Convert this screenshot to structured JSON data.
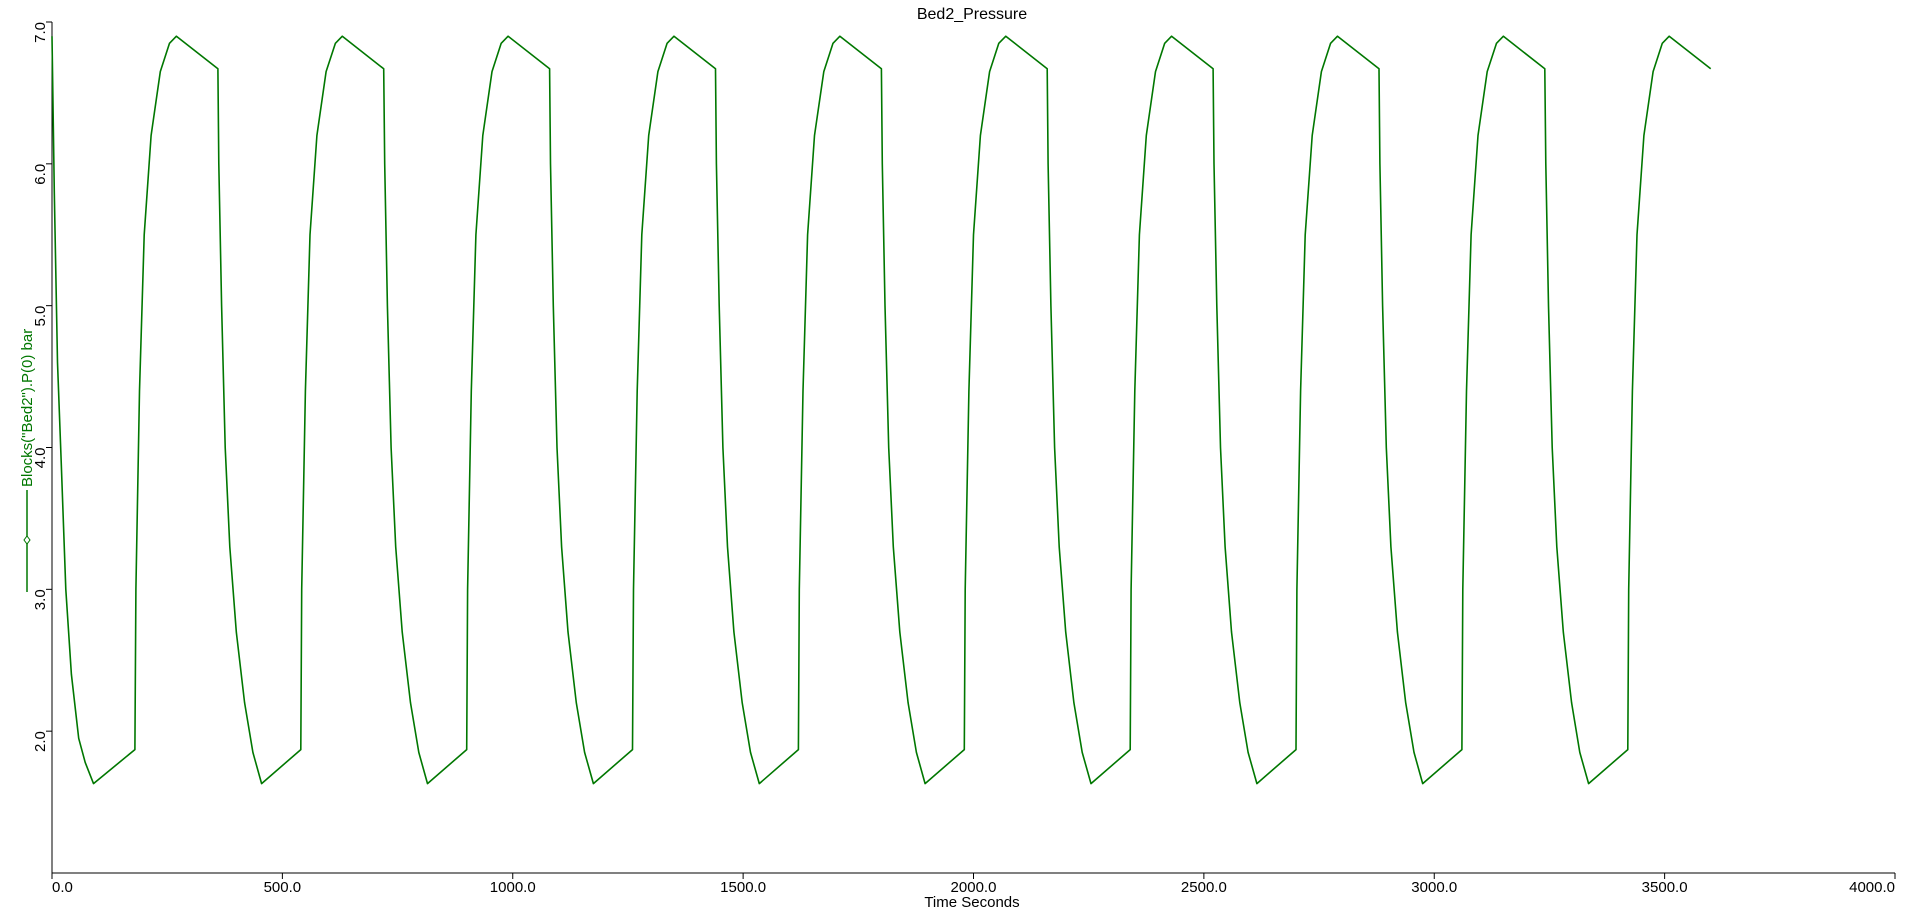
{
  "chart_data": {
    "type": "line",
    "title": "Bed2_Pressure",
    "xlabel": "Time Seconds",
    "ylabel": "Blocks(\"Bed2\").P(0) bar",
    "xlim": [
      0,
      4000
    ],
    "ylim": [
      1.0,
      7.0
    ],
    "x_ticks": [
      "0.0",
      "500.0",
      "1000.0",
      "1500.0",
      "2000.0",
      "2500.0",
      "3000.0",
      "3500.0",
      "4000.0"
    ],
    "x_tick_values": [
      0,
      500,
      1000,
      1500,
      2000,
      2500,
      3000,
      3500,
      4000
    ],
    "y_ticks": [
      "2.0",
      "3.0",
      "4.0",
      "5.0",
      "6.0",
      "7.0"
    ],
    "y_tick_values": [
      2,
      3,
      4,
      5,
      6,
      7
    ],
    "grid": false,
    "legend": "left, vertical along y-axis label",
    "series": [
      {
        "name": "Blocks(\"Bed2\").P(0) bar",
        "color": "#007700",
        "marker": "diamond",
        "points": [
          [
            0,
            6.9
          ],
          [
            5,
            5.8
          ],
          [
            12,
            4.6
          ],
          [
            20,
            3.9
          ],
          [
            30,
            3.0
          ],
          [
            42,
            2.4
          ],
          [
            58,
            1.95
          ],
          [
            72,
            1.78
          ],
          [
            90,
            1.63
          ],
          [
            180,
            1.87
          ],
          [
            182,
            3.0
          ],
          [
            190,
            4.4
          ],
          [
            200,
            5.5
          ],
          [
            215,
            6.2
          ],
          [
            235,
            6.65
          ],
          [
            255,
            6.85
          ],
          [
            270,
            6.9
          ],
          [
            360,
            6.67
          ],
          [
            362,
            6.0
          ],
          [
            368,
            5.0
          ],
          [
            376,
            4.0
          ],
          [
            386,
            3.3
          ],
          [
            400,
            2.7
          ],
          [
            418,
            2.2
          ],
          [
            436,
            1.85
          ],
          [
            455,
            1.63
          ],
          [
            540,
            1.87
          ],
          [
            542,
            3.0
          ],
          [
            550,
            4.4
          ],
          [
            560,
            5.5
          ],
          [
            575,
            6.2
          ],
          [
            595,
            6.65
          ],
          [
            615,
            6.85
          ],
          [
            630,
            6.9
          ],
          [
            720,
            6.67
          ],
          [
            722,
            6.0
          ],
          [
            728,
            5.0
          ],
          [
            736,
            4.0
          ],
          [
            746,
            3.3
          ],
          [
            760,
            2.7
          ],
          [
            778,
            2.2
          ],
          [
            796,
            1.85
          ],
          [
            815,
            1.63
          ],
          [
            900,
            1.87
          ],
          [
            902,
            3.0
          ],
          [
            910,
            4.4
          ],
          [
            920,
            5.5
          ],
          [
            935,
            6.2
          ],
          [
            955,
            6.65
          ],
          [
            975,
            6.85
          ],
          [
            990,
            6.9
          ],
          [
            1080,
            6.67
          ],
          [
            1082,
            6.0
          ],
          [
            1088,
            5.0
          ],
          [
            1096,
            4.0
          ],
          [
            1106,
            3.3
          ],
          [
            1120,
            2.7
          ],
          [
            1138,
            2.2
          ],
          [
            1156,
            1.85
          ],
          [
            1175,
            1.63
          ],
          [
            1260,
            1.87
          ],
          [
            1262,
            3.0
          ],
          [
            1270,
            4.4
          ],
          [
            1280,
            5.5
          ],
          [
            1295,
            6.2
          ],
          [
            1315,
            6.65
          ],
          [
            1335,
            6.85
          ],
          [
            1350,
            6.9
          ],
          [
            1440,
            6.67
          ],
          [
            1442,
            6.0
          ],
          [
            1448,
            5.0
          ],
          [
            1456,
            4.0
          ],
          [
            1466,
            3.3
          ],
          [
            1480,
            2.7
          ],
          [
            1498,
            2.2
          ],
          [
            1516,
            1.85
          ],
          [
            1535,
            1.63
          ],
          [
            1620,
            1.87
          ],
          [
            1622,
            3.0
          ],
          [
            1630,
            4.4
          ],
          [
            1640,
            5.5
          ],
          [
            1655,
            6.2
          ],
          [
            1675,
            6.65
          ],
          [
            1695,
            6.85
          ],
          [
            1710,
            6.9
          ],
          [
            1800,
            6.67
          ],
          [
            1802,
            6.0
          ],
          [
            1808,
            5.0
          ],
          [
            1816,
            4.0
          ],
          [
            1826,
            3.3
          ],
          [
            1840,
            2.7
          ],
          [
            1858,
            2.2
          ],
          [
            1876,
            1.85
          ],
          [
            1895,
            1.63
          ],
          [
            1980,
            1.87
          ],
          [
            1982,
            3.0
          ],
          [
            1990,
            4.4
          ],
          [
            2000,
            5.5
          ],
          [
            2015,
            6.2
          ],
          [
            2035,
            6.65
          ],
          [
            2055,
            6.85
          ],
          [
            2070,
            6.9
          ],
          [
            2160,
            6.67
          ],
          [
            2162,
            6.0
          ],
          [
            2168,
            5.0
          ],
          [
            2176,
            4.0
          ],
          [
            2186,
            3.3
          ],
          [
            2200,
            2.7
          ],
          [
            2218,
            2.2
          ],
          [
            2236,
            1.85
          ],
          [
            2255,
            1.63
          ],
          [
            2340,
            1.87
          ],
          [
            2342,
            3.0
          ],
          [
            2350,
            4.4
          ],
          [
            2360,
            5.5
          ],
          [
            2375,
            6.2
          ],
          [
            2395,
            6.65
          ],
          [
            2415,
            6.85
          ],
          [
            2430,
            6.9
          ],
          [
            2520,
            6.67
          ],
          [
            2522,
            6.0
          ],
          [
            2528,
            5.0
          ],
          [
            2536,
            4.0
          ],
          [
            2546,
            3.3
          ],
          [
            2560,
            2.7
          ],
          [
            2578,
            2.2
          ],
          [
            2596,
            1.85
          ],
          [
            2615,
            1.63
          ],
          [
            2700,
            1.87
          ],
          [
            2702,
            3.0
          ],
          [
            2710,
            4.4
          ],
          [
            2720,
            5.5
          ],
          [
            2735,
            6.2
          ],
          [
            2755,
            6.65
          ],
          [
            2775,
            6.85
          ],
          [
            2790,
            6.9
          ],
          [
            2880,
            6.67
          ],
          [
            2882,
            6.0
          ],
          [
            2888,
            5.0
          ],
          [
            2896,
            4.0
          ],
          [
            2906,
            3.3
          ],
          [
            2920,
            2.7
          ],
          [
            2938,
            2.2
          ],
          [
            2956,
            1.85
          ],
          [
            2975,
            1.63
          ],
          [
            3060,
            1.87
          ],
          [
            3062,
            3.0
          ],
          [
            3070,
            4.4
          ],
          [
            3080,
            5.5
          ],
          [
            3095,
            6.2
          ],
          [
            3115,
            6.65
          ],
          [
            3135,
            6.85
          ],
          [
            3150,
            6.9
          ],
          [
            3240,
            6.67
          ],
          [
            3242,
            6.0
          ],
          [
            3248,
            5.0
          ],
          [
            3256,
            4.0
          ],
          [
            3266,
            3.3
          ],
          [
            3280,
            2.7
          ],
          [
            3298,
            2.2
          ],
          [
            3316,
            1.85
          ],
          [
            3335,
            1.63
          ],
          [
            3420,
            1.87
          ],
          [
            3422,
            3.0
          ],
          [
            3430,
            4.4
          ],
          [
            3440,
            5.5
          ],
          [
            3455,
            6.2
          ],
          [
            3475,
            6.65
          ],
          [
            3495,
            6.85
          ],
          [
            3510,
            6.9
          ],
          [
            3600,
            6.67
          ]
        ]
      }
    ]
  }
}
